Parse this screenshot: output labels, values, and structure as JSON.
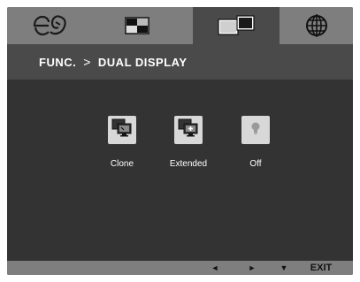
{
  "tabs": [
    {
      "id": "energy-saving",
      "icon": "energy-saving-icon",
      "active": false
    },
    {
      "id": "picture",
      "icon": "picture-icon",
      "active": false
    },
    {
      "id": "function",
      "icon": "dual-display-icon",
      "active": true
    },
    {
      "id": "setup",
      "icon": "globe-icon",
      "active": false
    }
  ],
  "breadcrumb": {
    "parent": "FUNC.",
    "separator": ">",
    "current": "DUAL DISPLAY"
  },
  "options": [
    {
      "label": "Clone",
      "icon": "clone-monitors-icon"
    },
    {
      "label": "Extended",
      "icon": "extended-monitors-icon"
    },
    {
      "label": "Off",
      "icon": "light-bulb-icon"
    }
  ],
  "footer": {
    "left_arrow": "◄",
    "right_arrow": "►",
    "down_arrow": "▼",
    "exit_label": "EXIT"
  },
  "colors": {
    "tab_bar": "#7e7e7e",
    "active_tab": "#4a4a4a",
    "panel": "#333333",
    "option_button": "#d8d8d8",
    "text": "#ffffff"
  }
}
